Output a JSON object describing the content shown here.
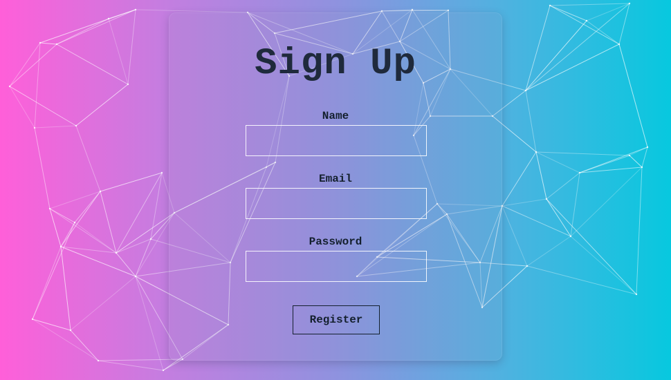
{
  "form": {
    "title": "Sign Up",
    "fields": [
      {
        "label": "Name",
        "value": "",
        "type": "text"
      },
      {
        "label": "Email",
        "value": "",
        "type": "email"
      },
      {
        "label": "Password",
        "value": "",
        "type": "password"
      }
    ],
    "submit_label": "Register"
  },
  "theme": {
    "gradient_start": "#ff5fd9",
    "gradient_end": "#07c8df",
    "text_color": "#14202e",
    "network_line_color": "#ffffff"
  }
}
